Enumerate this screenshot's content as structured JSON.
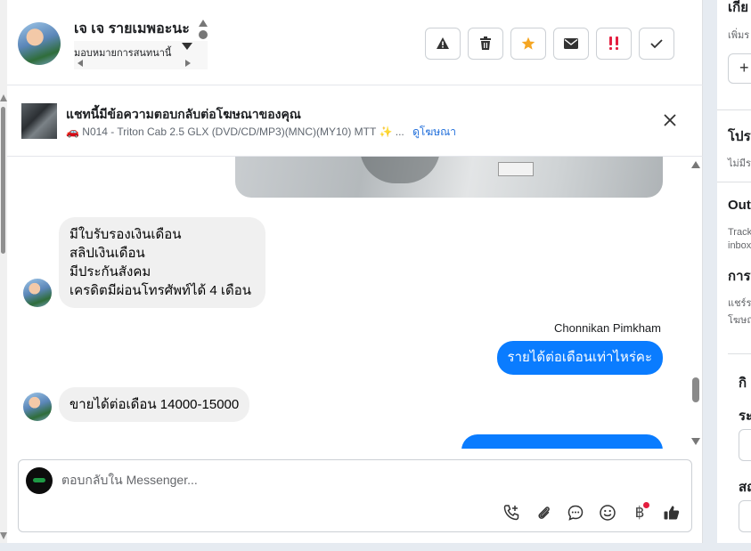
{
  "header": {
    "contact_name": "เจ เจ รายเมพอะนะ",
    "assign_label": "มอบหมายการสนทนานี้"
  },
  "actions": [
    {
      "name": "report-button",
      "icon": "warning-icon"
    },
    {
      "name": "delete-button",
      "icon": "trash-icon"
    },
    {
      "name": "star-button",
      "icon": "star-icon",
      "color": "#f5a623"
    },
    {
      "name": "mark-unread-button",
      "icon": "envelope-icon"
    },
    {
      "name": "priority-button",
      "icon": "double-exclamation-icon",
      "color": "#e41e3f"
    },
    {
      "name": "done-button",
      "icon": "check-icon"
    }
  ],
  "ad_banner": {
    "title": "แชทนี้มีข้อความตอบกลับต่อโฆษณาของคุณ",
    "subtitle": "N014 - Triton Cab 2.5 GLX (DVD/CD/MP3)(MNC)(MY10) MTT ✨ ...",
    "link": "ดูโฆษณา"
  },
  "messages": {
    "incoming_1": [
      "มีใบรับรองเงินเดือน",
      "สลิปเงินเดือน",
      "มีประกันสังคม",
      "เครดิตมีผ่อนโทรศัพท์ได้ 4 เดือน"
    ],
    "sender_name": "Chonnikan Pimkham",
    "outgoing_1": "รายได้ต่อเดือนเท่าไหร่คะ",
    "incoming_2": "ขายได้ต่อเดือน 14000-15000"
  },
  "composer": {
    "placeholder": "ตอบกลับใน Messenger...",
    "currency_symbol": "฿"
  },
  "right_panel": {
    "title_1": "เกีย",
    "sub_1": "เพิ่มร",
    "plus": "+",
    "title_2": "โปร",
    "sub_2": "ไม่มีร",
    "title_3": "Out",
    "sub_3a": "Track",
    "sub_3b": "inbox",
    "title_4": "การ",
    "sub_4a": "แชร์ร",
    "sub_4b": "โฆษณ",
    "title_5": "กิ",
    "title_6": "ระ",
    "title_7": "สถ"
  },
  "colors": {
    "accent_blue": "#0a7cff",
    "link_blue": "#216fdb",
    "star": "#f5a623",
    "priority_red": "#e41e3f"
  }
}
